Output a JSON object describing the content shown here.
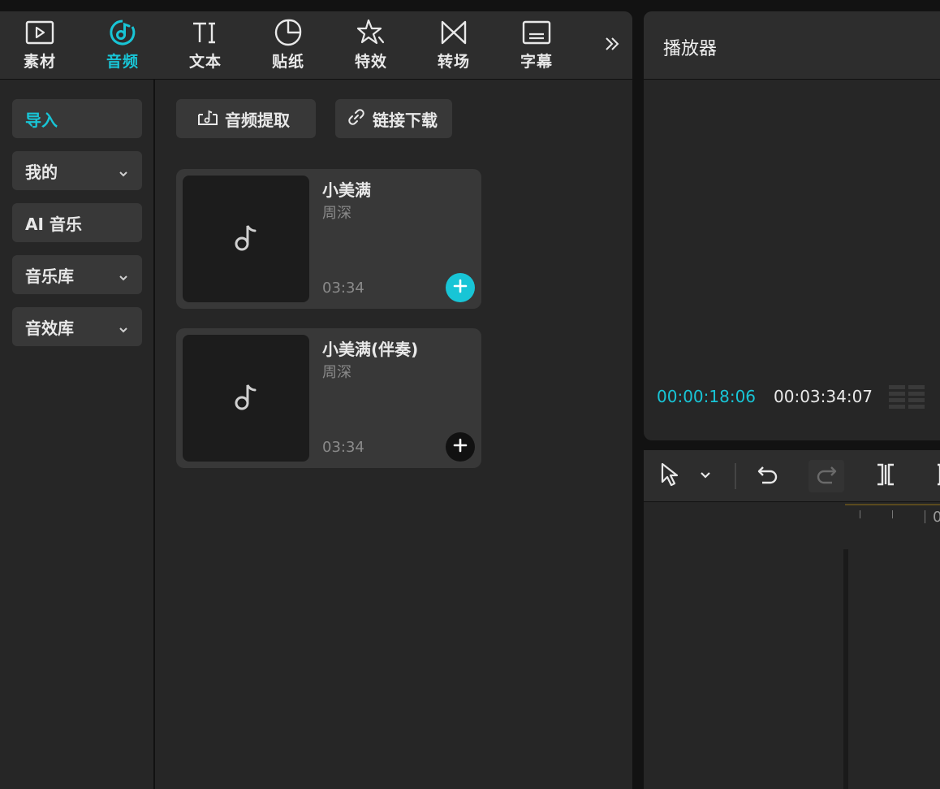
{
  "tabs": [
    {
      "label": "素材",
      "icon": "media-play-icon",
      "active": false
    },
    {
      "label": "音频",
      "icon": "audio-disc-icon",
      "active": true
    },
    {
      "label": "文本",
      "icon": "text-icon",
      "active": false
    },
    {
      "label": "贴纸",
      "icon": "sticker-icon",
      "active": false
    },
    {
      "label": "特效",
      "icon": "effects-star-icon",
      "active": false
    },
    {
      "label": "转场",
      "icon": "transition-icon",
      "active": false
    },
    {
      "label": "字幕",
      "icon": "subtitles-icon",
      "active": false
    }
  ],
  "sidebar": {
    "items": [
      {
        "label": "导入",
        "active": true,
        "expandable": false
      },
      {
        "label": "我的",
        "active": false,
        "expandable": true
      },
      {
        "label": "AI 音乐",
        "active": false,
        "expandable": false
      },
      {
        "label": "音乐库",
        "active": false,
        "expandable": true
      },
      {
        "label": "音效库",
        "active": false,
        "expandable": true
      }
    ]
  },
  "actions": {
    "extract_label": "音频提取",
    "link_download_label": "链接下载"
  },
  "tracks": [
    {
      "title": "小美满",
      "artist": "周深",
      "duration": "03:34",
      "add_style": "teal"
    },
    {
      "title": "小美满(伴奏)",
      "artist": "周深",
      "duration": "03:34",
      "add_style": "dark"
    }
  ],
  "player": {
    "title": "播放器",
    "current_time": "00:00:18:06",
    "total_time": "00:03:34:07"
  },
  "timeline": {
    "ruler_label": "0"
  },
  "colors": {
    "accent": "#18c5d6",
    "panel": "#262626",
    "header": "#2d2d2d",
    "button": "#383838"
  }
}
